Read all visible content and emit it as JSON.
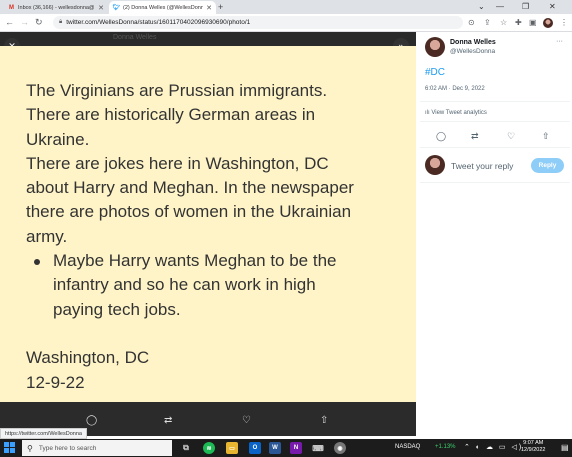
{
  "browser": {
    "tabs": [
      {
        "icon": "gmail-icon",
        "title": "Inbox (36,166) - wellesdonna@..."
      },
      {
        "icon": "twitter-icon",
        "title": "(2) Donna Welles (@WellesDonna..."
      }
    ],
    "url": "twitter.com/WellesDonna/status/1601170402096930690/photo/1",
    "status_url": "https://twitter.com/WellesDonna"
  },
  "viewer": {
    "header_name": "Donna Welles",
    "photo_lines": [
      "The Virginians are Prussian immigrants.",
      "There are historically German areas in",
      "Ukraine.",
      "There are jokes here in Washington, DC",
      "about Harry and Meghan. In the newspaper",
      "there are photos of women in the Ukrainian",
      "army."
    ],
    "photo_bullet": [
      "Maybe Harry wants Meghan to be the",
      "infantry and so he can work in high",
      "paying tech jobs."
    ],
    "photo_footer": [
      "Washington, DC",
      "12-9-22"
    ],
    "actions": [
      "reply-icon",
      "retweet-icon",
      "like-icon",
      "share-icon"
    ]
  },
  "sidebar": {
    "name": "Donna Welles",
    "handle": "@WellesDonna",
    "tweet_text": "#DC",
    "timestamp": "6:02 AM · Dec 9, 2022",
    "analytics": "View Tweet analytics",
    "reply_placeholder": "Tweet your reply",
    "reply_button": "Reply"
  },
  "taskbar": {
    "search_placeholder": "Type here to search",
    "ticker": "NASDAQ",
    "ticker_change": "+1.13%",
    "time": "9:07 AM",
    "date": "12/9/2022"
  },
  "colors": {
    "accent": "#1d9bf0",
    "photo_bg": "#fff4c7"
  }
}
